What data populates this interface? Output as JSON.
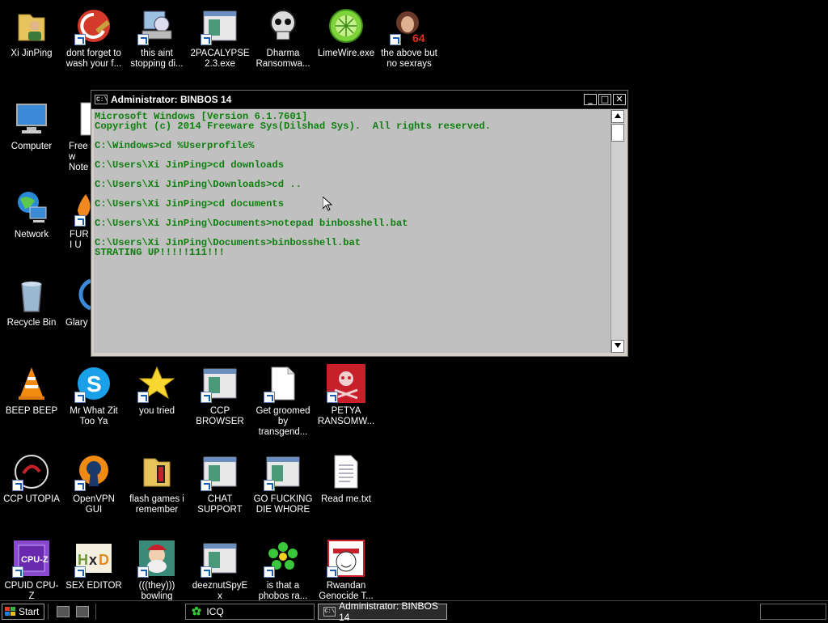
{
  "desktop_icons": [
    {
      "label": "Xi JinPing"
    },
    {
      "label": "dont forget to wash your f..."
    },
    {
      "label": "this aint stopping di..."
    },
    {
      "label": "2PACALYPSE 2.3.exe"
    },
    {
      "label": "Dharma Ransomwa..."
    },
    {
      "label": "LimeWire.exe"
    },
    {
      "label": "the above but no sexrays"
    },
    {
      "label": "Computer"
    },
    {
      "label": "Freew Note"
    },
    {
      "label": "Network"
    },
    {
      "label": "FURI U"
    },
    {
      "label": "Recycle Bin"
    },
    {
      "label": "Glary"
    },
    {
      "label": "BEEP BEEP"
    },
    {
      "label": "Mr What Zit Too Ya"
    },
    {
      "label": "you tried"
    },
    {
      "label": "CCP BROWSER"
    },
    {
      "label": "Get groomed by transgend..."
    },
    {
      "label": "PETYA RANSOMW..."
    },
    {
      "label": "CCP UTOPIA"
    },
    {
      "label": "OpenVPN GUI"
    },
    {
      "label": "flash games i remember"
    },
    {
      "label": "CHAT SUPPORT"
    },
    {
      "label": "GO FUCKING DIE WHORE"
    },
    {
      "label": "Read me.txt"
    },
    {
      "label": "CPUID CPU-Z"
    },
    {
      "label": "SEX EDITOR"
    },
    {
      "label": "(((they))) bowling"
    },
    {
      "label": "deeznutSpyEx"
    },
    {
      "label": "is that a phobos ra..."
    },
    {
      "label": "Rwandan Genocide T..."
    }
  ],
  "console": {
    "title": "Administrator:  BINBOS 14",
    "icon_text": "C:\\",
    "minimize": "_",
    "maximize": "□",
    "close": "✕",
    "lines": [
      "Microsoft Windows [Version 6.1.7601]",
      "Copyright (c) 2014 Freeware Sys(Dilshad Sys).  All rights reserved.",
      "",
      "C:\\Windows>cd %Userprofile%",
      "",
      "C:\\Users\\Xi JinPing>cd downloads",
      "",
      "C:\\Users\\Xi JinPing\\Downloads>cd ..",
      "",
      "C:\\Users\\Xi JinPing>cd documents",
      "",
      "C:\\Users\\Xi JinPing\\Documents>notepad binbosshell.bat",
      "",
      "C:\\Users\\Xi JinPing\\Documents>binbosshell.bat",
      "STRATING UP!!!!!111!!!"
    ]
  },
  "taskbar": {
    "start_label": "Start",
    "tasks": [
      {
        "label": "ICQ"
      },
      {
        "label": "Administrator:  BINBOS 14"
      }
    ]
  },
  "colors": {
    "console_text": "#0f7f0f",
    "console_bg": "#c0c0c0",
    "desktop_bg": "#000000"
  }
}
